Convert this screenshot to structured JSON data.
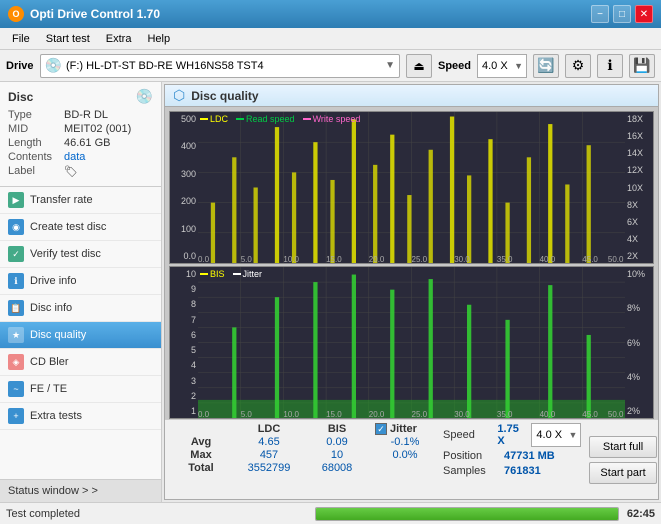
{
  "titleBar": {
    "title": "Opti Drive Control 1.70",
    "controls": [
      "−",
      "□",
      "✕"
    ]
  },
  "menuBar": {
    "items": [
      "File",
      "Start test",
      "Extra",
      "Help"
    ]
  },
  "toolbar": {
    "driveLabel": "Drive",
    "driveIcon": "💿",
    "driveText": "(F:)  HL-DT-ST BD-RE  WH16NS58 TST4",
    "speedLabel": "Speed",
    "speedValue": "4.0 X"
  },
  "disc": {
    "title": "Disc",
    "fields": [
      {
        "key": "Type",
        "val": "BD-R DL",
        "color": "black"
      },
      {
        "key": "MID",
        "val": "MEIT02 (001)",
        "color": "black"
      },
      {
        "key": "Length",
        "val": "46.61 GB",
        "color": "black"
      },
      {
        "key": "Contents",
        "val": "data",
        "color": "blue"
      },
      {
        "key": "Label",
        "val": "",
        "color": "black"
      }
    ]
  },
  "navItems": [
    {
      "label": "Transfer rate",
      "icon": "▶",
      "iconColor": "green",
      "active": false
    },
    {
      "label": "Create test disc",
      "icon": "◉",
      "iconColor": "blue",
      "active": false
    },
    {
      "label": "Verify test disc",
      "icon": "✓",
      "iconColor": "green",
      "active": false
    },
    {
      "label": "Drive info",
      "icon": "ℹ",
      "iconColor": "blue",
      "active": false
    },
    {
      "label": "Disc info",
      "icon": "📋",
      "iconColor": "blue",
      "active": false
    },
    {
      "label": "Disc quality",
      "icon": "★",
      "iconColor": "blue",
      "active": true
    },
    {
      "label": "CD Bler",
      "icon": "◈",
      "iconColor": "orange",
      "active": false
    },
    {
      "label": "FE / TE",
      "icon": "~",
      "iconColor": "blue",
      "active": false
    },
    {
      "label": "Extra tests",
      "icon": "+",
      "iconColor": "blue",
      "active": false
    }
  ],
  "statusWindowBtn": "Status window > >",
  "discQuality": {
    "title": "Disc quality",
    "legend1": [
      "LDC",
      "Read speed",
      "Write speed"
    ],
    "legend2": [
      "BIS",
      "Jitter"
    ],
    "chart1": {
      "yLeft": [
        "500",
        "400",
        "300",
        "200",
        "100",
        "0"
      ],
      "yRight": [
        "18X",
        "16X",
        "14X",
        "12X",
        "10X",
        "8X",
        "6X",
        "4X",
        "2X"
      ],
      "xLabels": [
        "0.0",
        "5.0",
        "10.0",
        "15.0",
        "20.0",
        "25.0",
        "30.0",
        "35.0",
        "40.0",
        "45.0",
        "50.0 GB"
      ]
    },
    "chart2": {
      "yLeft": [
        "10",
        "9",
        "8",
        "7",
        "6",
        "5",
        "4",
        "3",
        "2",
        "1"
      ],
      "yRight": [
        "10%",
        "8%",
        "6%",
        "4%",
        "2%"
      ],
      "xLabels": [
        "0.0",
        "5.0",
        "10.0",
        "15.0",
        "20.0",
        "25.0",
        "30.0",
        "35.0",
        "40.0",
        "45.0",
        "50.0 GB"
      ]
    }
  },
  "stats": {
    "headers": [
      "",
      "LDC",
      "BIS",
      "",
      "Jitter",
      "Speed",
      ""
    ],
    "avgLabel": "Avg",
    "avgLDC": "4.65",
    "avgBIS": "0.09",
    "avgJitter": "-0.1%",
    "maxLabel": "Max",
    "maxLDC": "457",
    "maxBIS": "10",
    "maxJitter": "0.0%",
    "totalLabel": "Total",
    "totalLDC": "3552799",
    "totalBIS": "68008",
    "speedLabel": "Speed",
    "speedVal": "1.75 X",
    "speedDropdown": "4.0 X",
    "positionLabel": "Position",
    "positionVal": "47731 MB",
    "samplesLabel": "Samples",
    "samplesVal": "761831",
    "startFullBtn": "Start full",
    "startPartBtn": "Start part"
  },
  "statusBar": {
    "text": "Test completed",
    "progress": 100,
    "time": "62:45"
  }
}
